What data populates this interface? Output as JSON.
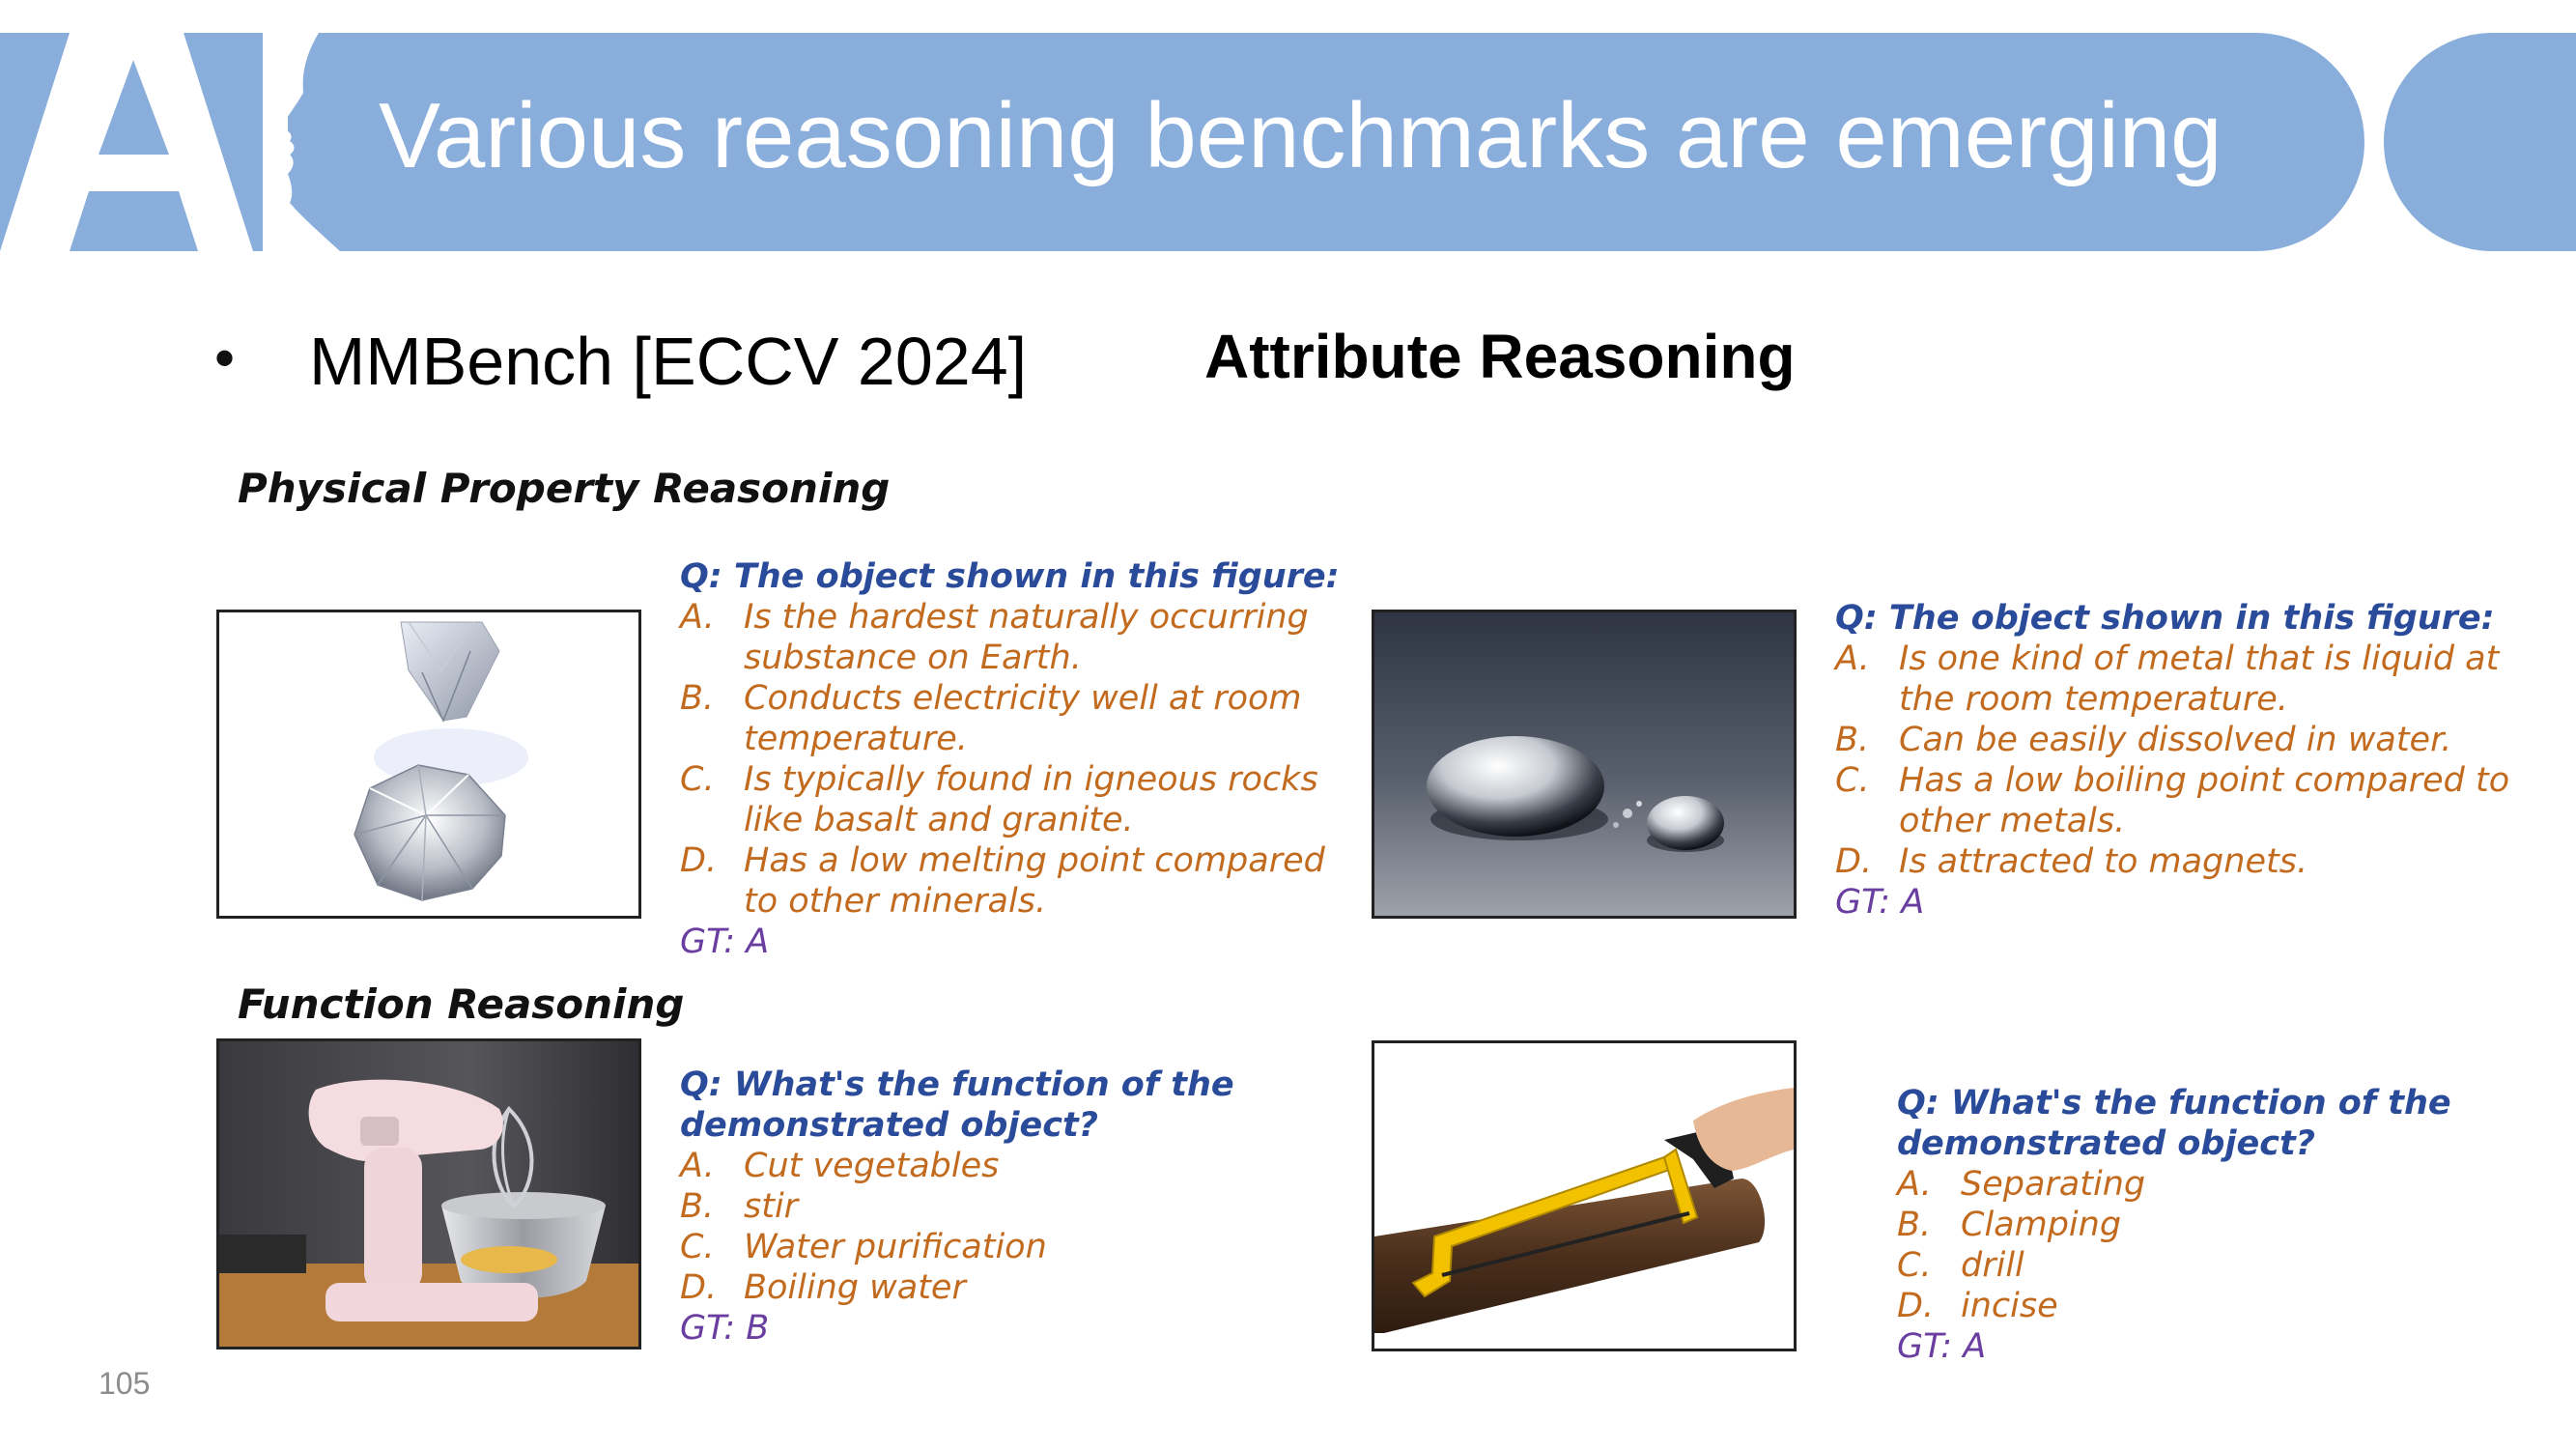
{
  "header": {
    "title": "Various reasoning benchmarks are emerging",
    "logo_text": "AI",
    "color": "#8aaedb"
  },
  "bullet": {
    "marker": "•",
    "text": "MMBench [ECCV 2024]"
  },
  "heading": "Attribute Reasoning",
  "sections": {
    "physical": "Physical Property Reasoning",
    "function": "Function Reasoning"
  },
  "questions": [
    {
      "question": "Q: The object shown in this figure:",
      "options": [
        {
          "letter": "A.",
          "text": "Is the hardest naturally occurring substance on Earth."
        },
        {
          "letter": "B.",
          "text": "Conducts electricity well at room temperature."
        },
        {
          "letter": "C.",
          "text": "Is typically found in igneous rocks like basalt and granite."
        },
        {
          "letter": "D.",
          "text": "Has a low melting point compared to other minerals."
        }
      ],
      "gt": "GT: A"
    },
    {
      "question": "Q: The object shown in this figure:",
      "options": [
        {
          "letter": "A.",
          "text": "Is one kind of metal that is liquid at the room temperature."
        },
        {
          "letter": "B.",
          "text": "Can be easily dissolved in water."
        },
        {
          "letter": "C.",
          "text": "Has a low boiling point compared to other metals."
        },
        {
          "letter": "D.",
          "text": "Is attracted to magnets."
        }
      ],
      "gt": "GT: A"
    },
    {
      "question": "Q: What's the function of the demonstrated object?",
      "options": [
        {
          "letter": "A.",
          "text": "Cut vegetables"
        },
        {
          "letter": "B.",
          "text": "stir"
        },
        {
          "letter": "C.",
          "text": "Water purification"
        },
        {
          "letter": "D.",
          "text": "Boiling water"
        }
      ],
      "gt": "GT: B"
    },
    {
      "question": "Q: What's the function of the demonstrated object?",
      "options": [
        {
          "letter": "A.",
          "text": "Separating"
        },
        {
          "letter": "B.",
          "text": "Clamping"
        },
        {
          "letter": "C.",
          "text": "drill"
        },
        {
          "letter": "D.",
          "text": "incise"
        }
      ],
      "gt": "GT: A"
    }
  ],
  "page_number": "105"
}
